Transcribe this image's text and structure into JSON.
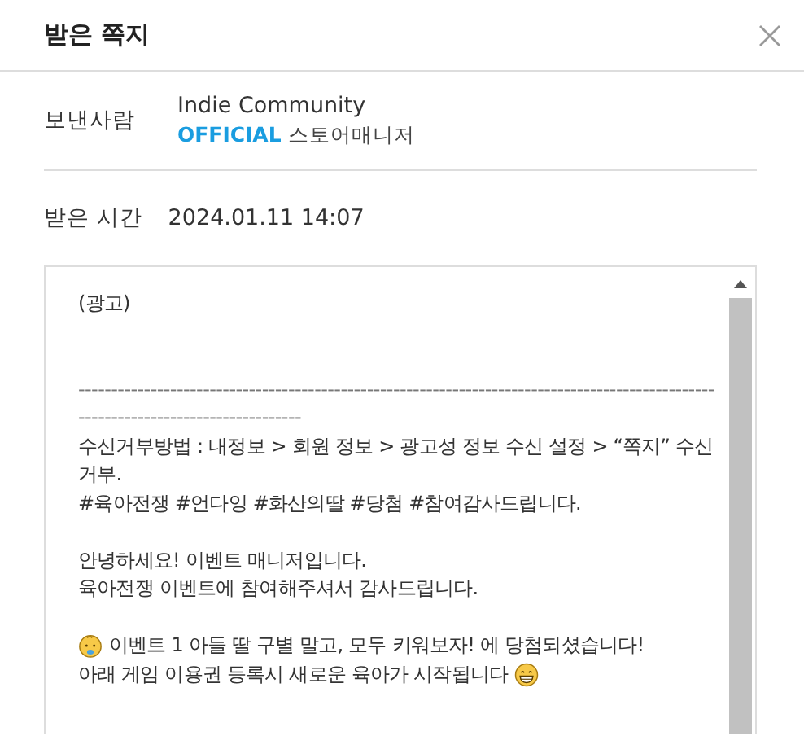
{
  "window": {
    "title": "받은 쪽지"
  },
  "sender": {
    "label": "보낸사람",
    "name": "Indie Community",
    "badge": "OFFICIAL",
    "role": "스토어매니저"
  },
  "received": {
    "label": "받은 시간",
    "value": "2024.01.11 14:07"
  },
  "message": {
    "lines": [
      {
        "kind": "text",
        "text": "(광고)"
      },
      {
        "kind": "blank"
      },
      {
        "kind": "blank"
      },
      {
        "kind": "rule",
        "text": "-----------------------------------------------------------------------------------------------------------------------------------"
      },
      {
        "kind": "text",
        "text": "수신거부방법 : 내정보 > 회원 정보 > 광고성 정보 수신 설정 > “쪽지” 수신거부."
      },
      {
        "kind": "text",
        "text": "#육아전쟁 #언다잉 #화산의딸 #당첨 #참여감사드립니다."
      },
      {
        "kind": "blank"
      },
      {
        "kind": "text",
        "text": "안녕하세요! 이벤트 매니저입니다."
      },
      {
        "kind": "text",
        "text": "육아전쟁 이벤트에 참여해주셔서 감사드립니다."
      },
      {
        "kind": "blank"
      },
      {
        "kind": "lead_icon",
        "text": "이벤트 1 아들 딸 구별 말고, 모두 키워보자! 에 당첨되셨습니다!"
      },
      {
        "kind": "trail_icon",
        "text": "아래 게임 이용권 등록시 새로운 육아가 시작됩니다"
      }
    ]
  }
}
